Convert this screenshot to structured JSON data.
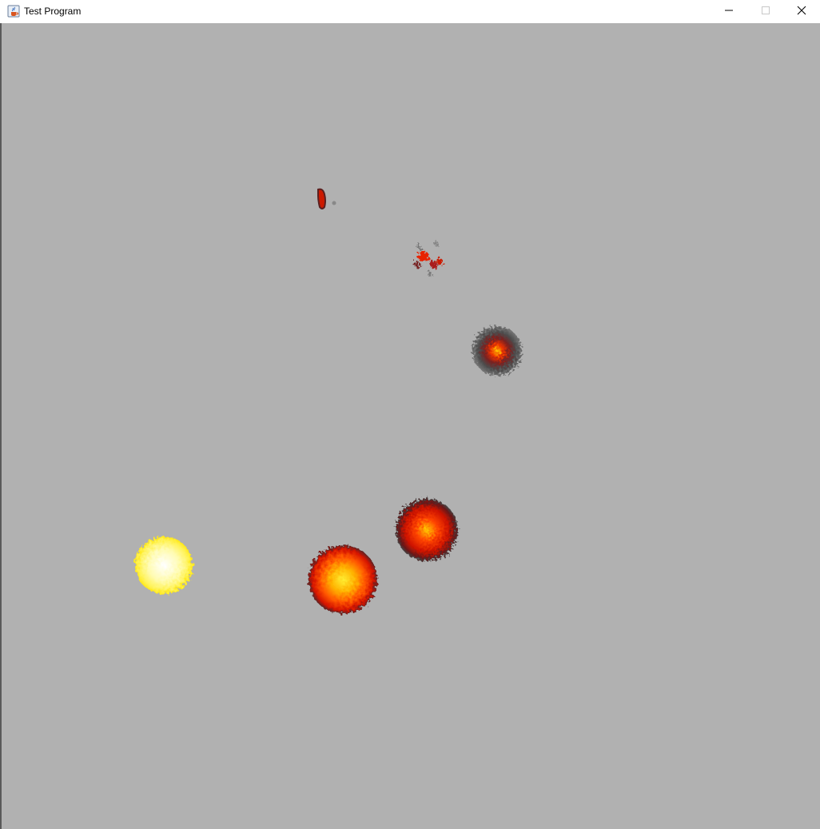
{
  "window": {
    "title": "Test Program",
    "app_icon": "java-cup-icon",
    "controls": {
      "minimize_icon": "minimize-icon",
      "maximize_icon": "maximize-icon",
      "close_icon": "close-icon"
    }
  },
  "canvas": {
    "background": "#b1b1b1",
    "explosions": [
      {
        "name": "explosion-frame-1",
        "stage": "flash",
        "colors": [
          "#ffffff",
          "#fffa9a",
          "#ffee33"
        ]
      },
      {
        "name": "explosion-frame-2",
        "stage": "fireball",
        "colors": [
          "#ffee22",
          "#ff8800",
          "#dd1100",
          "#5a2020"
        ]
      },
      {
        "name": "explosion-frame-3",
        "stage": "burning",
        "colors": [
          "#ffdd00",
          "#ee2200",
          "#881111",
          "#4a4a4a"
        ]
      },
      {
        "name": "explosion-frame-4",
        "stage": "smoke",
        "colors": [
          "#ffcc00",
          "#ee2200",
          "#555555",
          "#777777"
        ]
      },
      {
        "name": "explosion-frame-5",
        "stage": "fading",
        "colors": [
          "#ee2200",
          "#661111",
          "#777777"
        ]
      },
      {
        "name": "explosion-frame-6",
        "stage": "remnant",
        "colors": [
          "#dd1100",
          "#661111",
          "#888888"
        ]
      }
    ]
  }
}
